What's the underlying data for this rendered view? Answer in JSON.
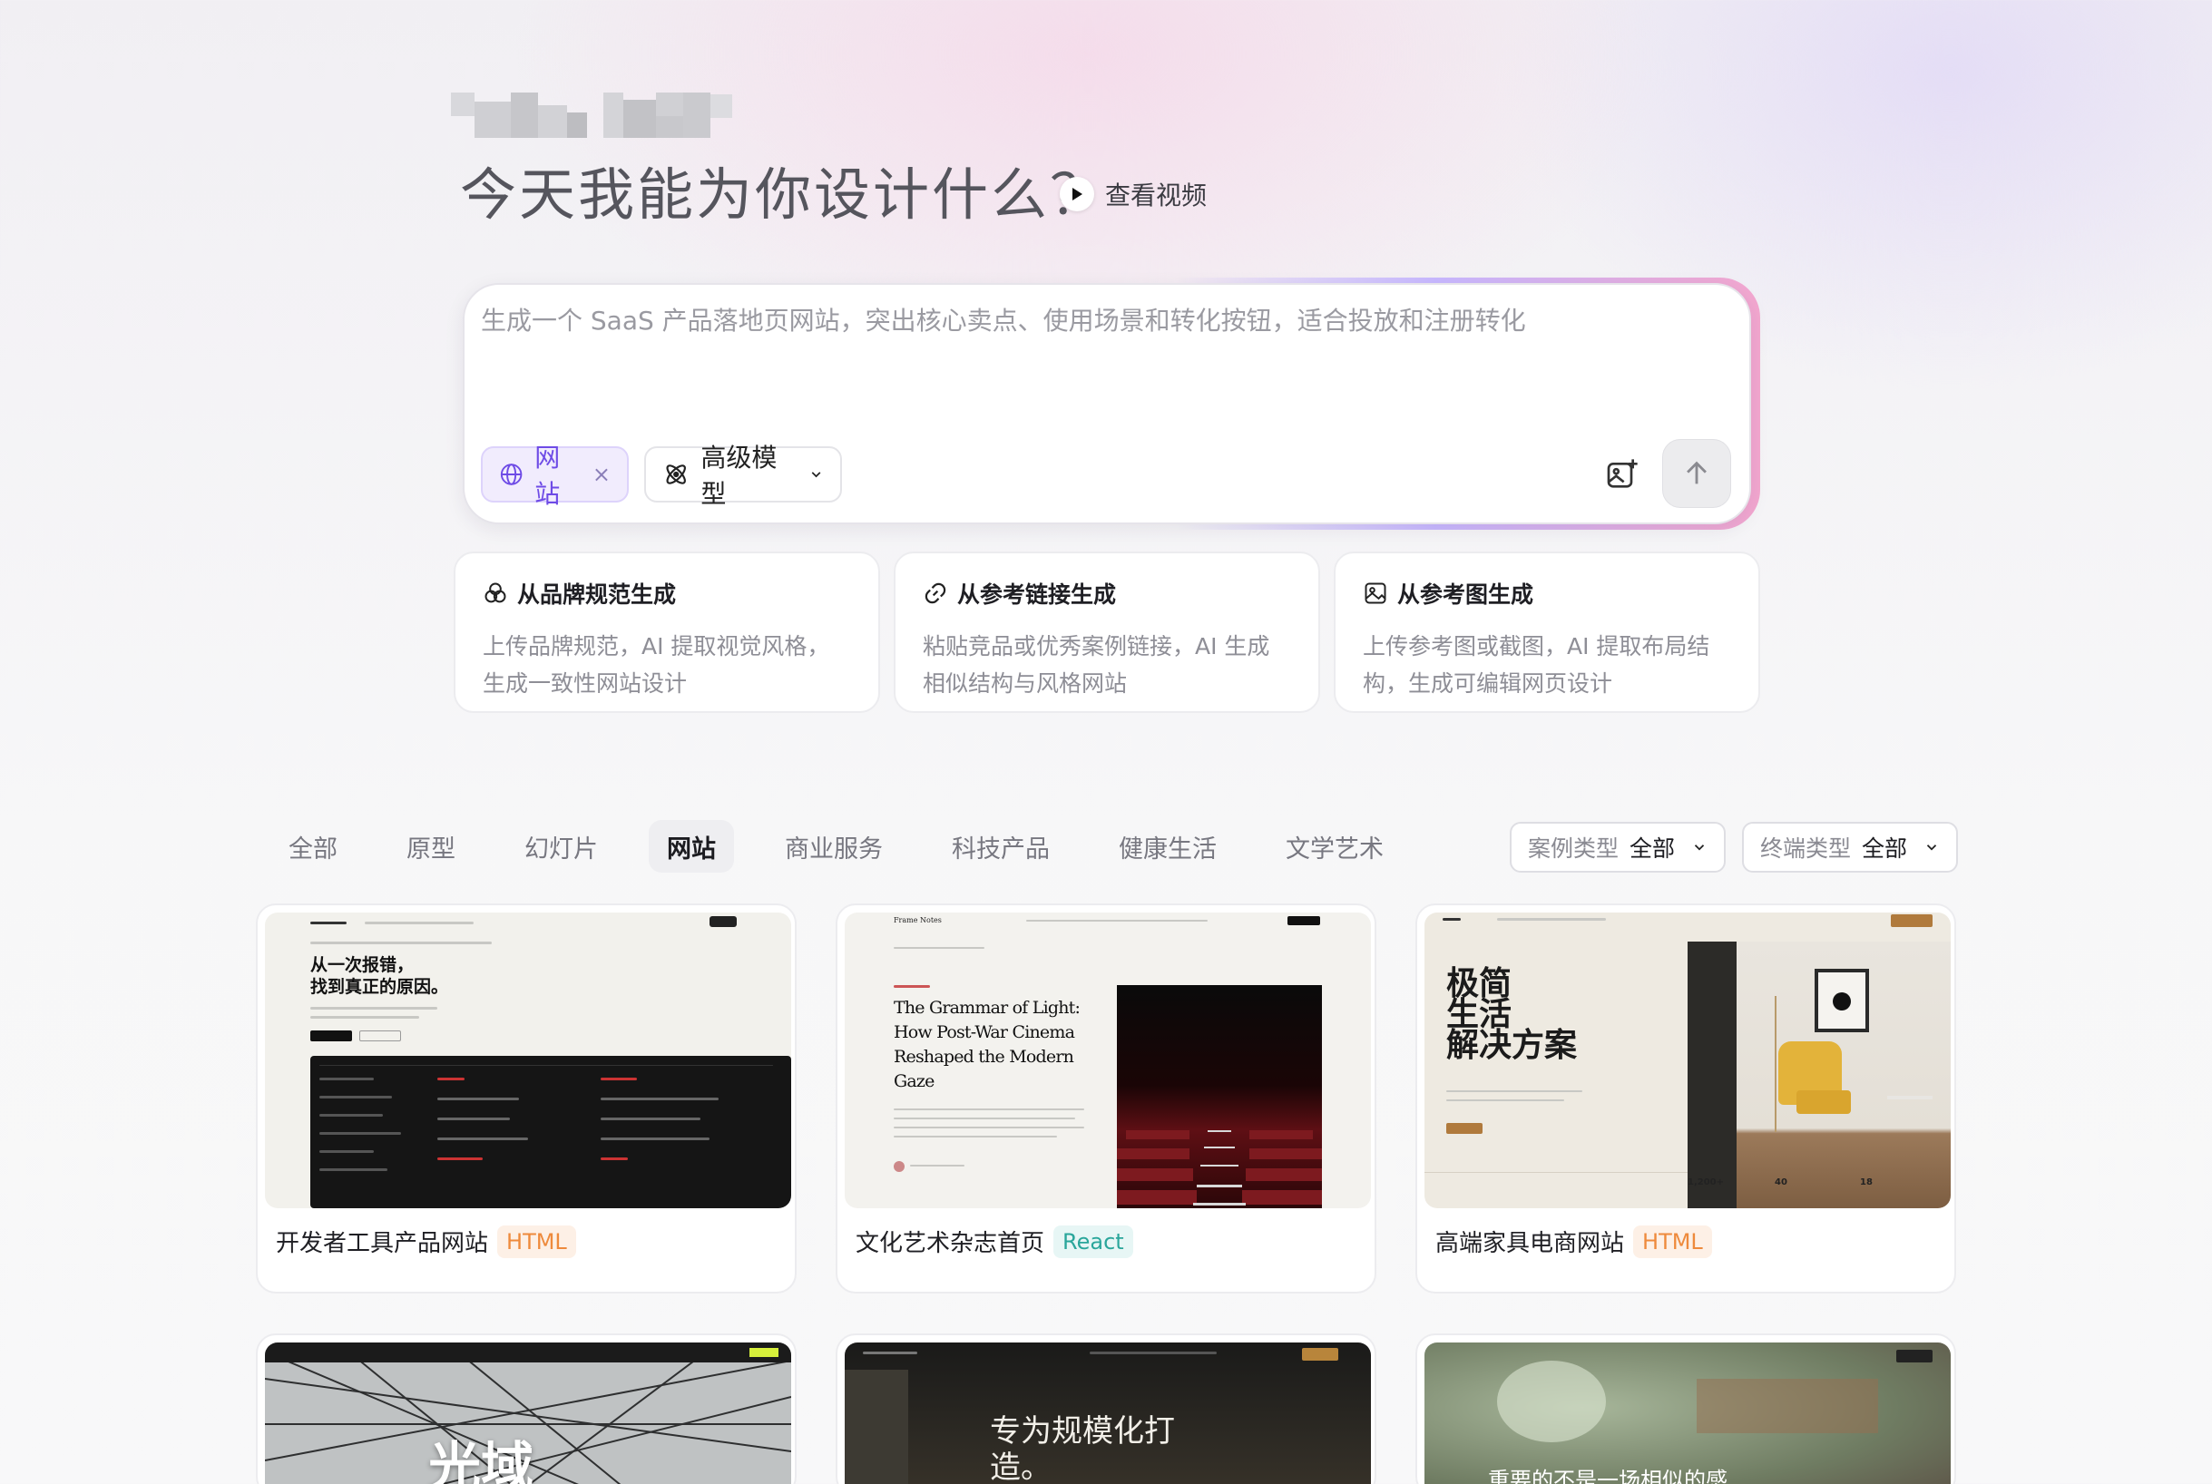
{
  "hero": {
    "title": "今天我能为你设计什么？",
    "video_label": "查看视频"
  },
  "prompt": {
    "placeholder": "生成一个 SaaS 产品落地页网站，突出核心卖点、使用场景和转化按钮，适合投放和注册转化",
    "chip_site": "网站",
    "chip_model": "高级模型"
  },
  "quick_cards": [
    {
      "title": "从品牌规范生成",
      "desc": "上传品牌规范，AI 提取视觉风格，生成一致性网站设计",
      "icon": "brand-icon"
    },
    {
      "title": "从参考链接生成",
      "desc": "粘贴竞品或优秀案例链接，AI 生成相似结构与风格网站",
      "icon": "link-icon"
    },
    {
      "title": "从参考图生成",
      "desc": "上传参考图或截图，AI 提取布局结构，生成可编辑网页设计",
      "icon": "image-icon"
    }
  ],
  "tabs": [
    "全部",
    "原型",
    "幻灯片",
    "网站",
    "商业服务",
    "科技产品",
    "健康生活",
    "文学艺术"
  ],
  "active_tab": "网站",
  "filters": {
    "case_type_label": "案例类型",
    "case_type_value": "全部",
    "device_type_label": "终端类型",
    "device_type_value": "全部"
  },
  "cards": [
    {
      "title": "开发者工具产品网站",
      "tag": "HTML",
      "thumb_heading_1": "从一次报错，",
      "thumb_heading_2": "找到真正的原因。"
    },
    {
      "title": "文化艺术杂志首页",
      "tag": "React",
      "thumb_brand": "Frame Notes",
      "thumb_heading_1": "The Grammar of Light:",
      "thumb_heading_2": "How Post-War Cinema",
      "thumb_heading_3": "Reshaped the Modern",
      "thumb_heading_4": "Gaze"
    },
    {
      "title": "高端家具电商网站",
      "tag": "HTML",
      "thumb_heading_1": "极简",
      "thumb_heading_2": "生活",
      "thumb_heading_3": "解决方案",
      "thumb_stat_1": "1,200+",
      "thumb_stat_2": "40",
      "thumb_stat_3": "18"
    },
    {
      "title": "",
      "tag": "",
      "thumb_heading_1": "光域"
    },
    {
      "title": "",
      "tag": "",
      "thumb_heading_1": "专为规模化打",
      "thumb_heading_2": "造。"
    },
    {
      "title": "",
      "tag": "",
      "thumb_heading_1": "重要的不是一场相似的感"
    }
  ],
  "colors": {
    "accent_purple": "#6e4be6",
    "tag_html": "#ee8a3c",
    "tag_react": "#2aa69b"
  }
}
